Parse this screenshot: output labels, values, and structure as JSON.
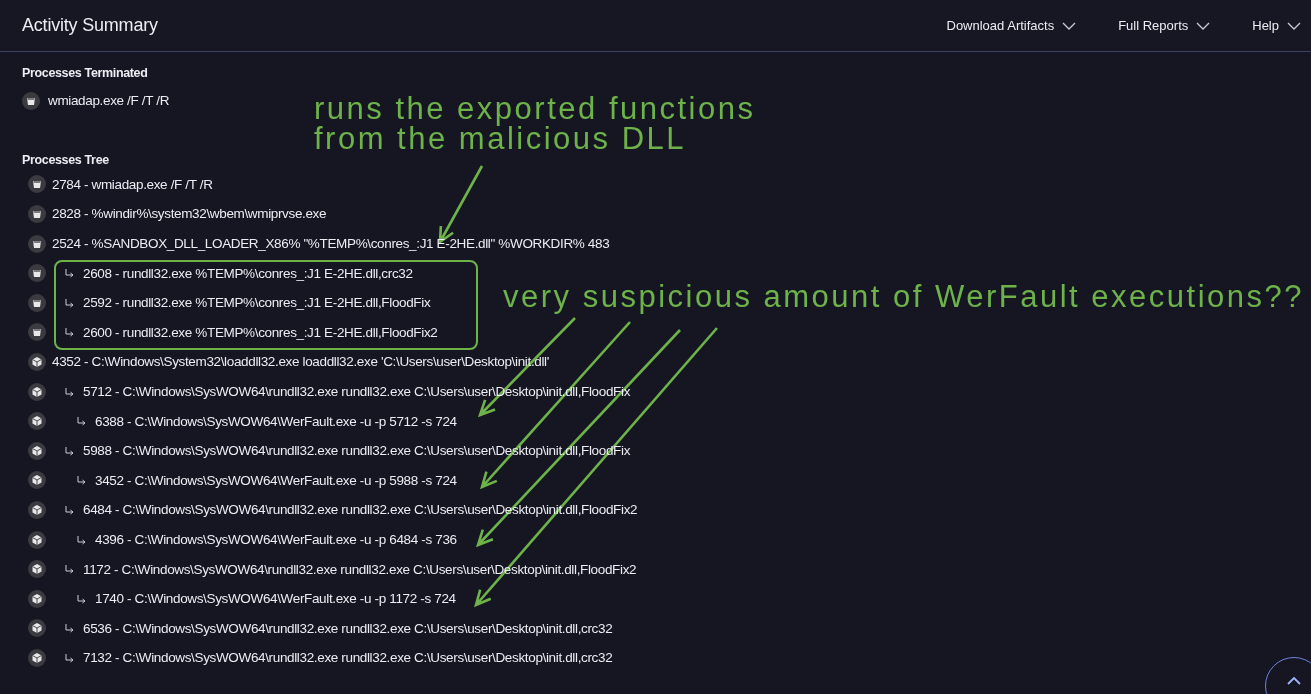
{
  "header": {
    "title": "Activity Summary",
    "menus": [
      {
        "label": "Download Artifacts"
      },
      {
        "label": "Full Reports"
      },
      {
        "label": "Help"
      }
    ]
  },
  "processes_terminated": {
    "title": "Processes Terminated",
    "items": [
      {
        "kind": "jar",
        "label": "wmiadap.exe /F /T /R"
      }
    ]
  },
  "processes_tree": {
    "title": "Processes Tree",
    "nodes": [
      {
        "kind": "jar",
        "label": "2784 - wmiadap.exe /F /T /R"
      },
      {
        "kind": "jar",
        "label": "2828 - %windir%\\system32\\wbem\\wmiprvse.exe"
      },
      {
        "kind": "jar",
        "label": "2524 - %SANDBOX_DLL_LOADER_X86% \"%TEMP%\\conres_:J1 E-2HE.dll\" %WORKDIR% 483",
        "children_highlighted": true,
        "children": [
          {
            "kind": "jar",
            "label": "2608 - rundll32.exe %TEMP%\\conres_:J1 E-2HE.dll,crc32"
          },
          {
            "kind": "jar",
            "label": "2592 - rundll32.exe %TEMP%\\conres_:J1 E-2HE.dll,FloodFix"
          },
          {
            "kind": "jar",
            "label": "2600 - rundll32.exe %TEMP%\\conres_:J1 E-2HE.dll,FloodFix2"
          }
        ]
      },
      {
        "kind": "cube",
        "label": "4352 - C:\\Windows\\System32\\loaddll32.exe loaddll32.exe 'C:\\Users\\user\\Desktop\\init.dll'",
        "children": [
          {
            "kind": "cube",
            "label": "5712 - C:\\Windows\\SysWOW64\\rundll32.exe rundll32.exe C:\\Users\\user\\Desktop\\init.dll,FloodFix",
            "children": [
              {
                "kind": "cube",
                "label": "6388 - C:\\Windows\\SysWOW64\\WerFault.exe -u -p 5712 -s 724"
              }
            ]
          },
          {
            "kind": "cube",
            "label": "5988 - C:\\Windows\\SysWOW64\\rundll32.exe rundll32.exe C:\\Users\\user\\Desktop\\init.dll,FloodFix",
            "children": [
              {
                "kind": "cube",
                "label": "3452 - C:\\Windows\\SysWOW64\\WerFault.exe -u -p 5988 -s 724"
              }
            ]
          },
          {
            "kind": "cube",
            "label": "6484 - C:\\Windows\\SysWOW64\\rundll32.exe rundll32.exe C:\\Users\\user\\Desktop\\init.dll,FloodFix2",
            "children": [
              {
                "kind": "cube",
                "label": "4396 - C:\\Windows\\SysWOW64\\WerFault.exe -u -p 6484 -s 736"
              }
            ]
          },
          {
            "kind": "cube",
            "label": "1172 - C:\\Windows\\SysWOW64\\rundll32.exe rundll32.exe C:\\Users\\user\\Desktop\\init.dll,FloodFix2",
            "children": [
              {
                "kind": "cube",
                "label": "1740 - C:\\Windows\\SysWOW64\\WerFault.exe -u -p 1172 -s 724"
              }
            ]
          },
          {
            "kind": "cube",
            "label": "6536 - C:\\Windows\\SysWOW64\\rundll32.exe rundll32.exe C:\\Users\\user\\Desktop\\init.dll,crc32"
          },
          {
            "kind": "cube",
            "label": "7132 - C:\\Windows\\SysWOW64\\rundll32.exe rundll32.exe C:\\Users\\user\\Desktop\\init.dll,crc32"
          }
        ]
      }
    ]
  },
  "annotations": [
    {
      "lines": [
        "runs the exported functions",
        "from the malicious DLL"
      ]
    },
    {
      "lines": [
        "very suspicious amount of WerFault executions??"
      ]
    }
  ]
}
